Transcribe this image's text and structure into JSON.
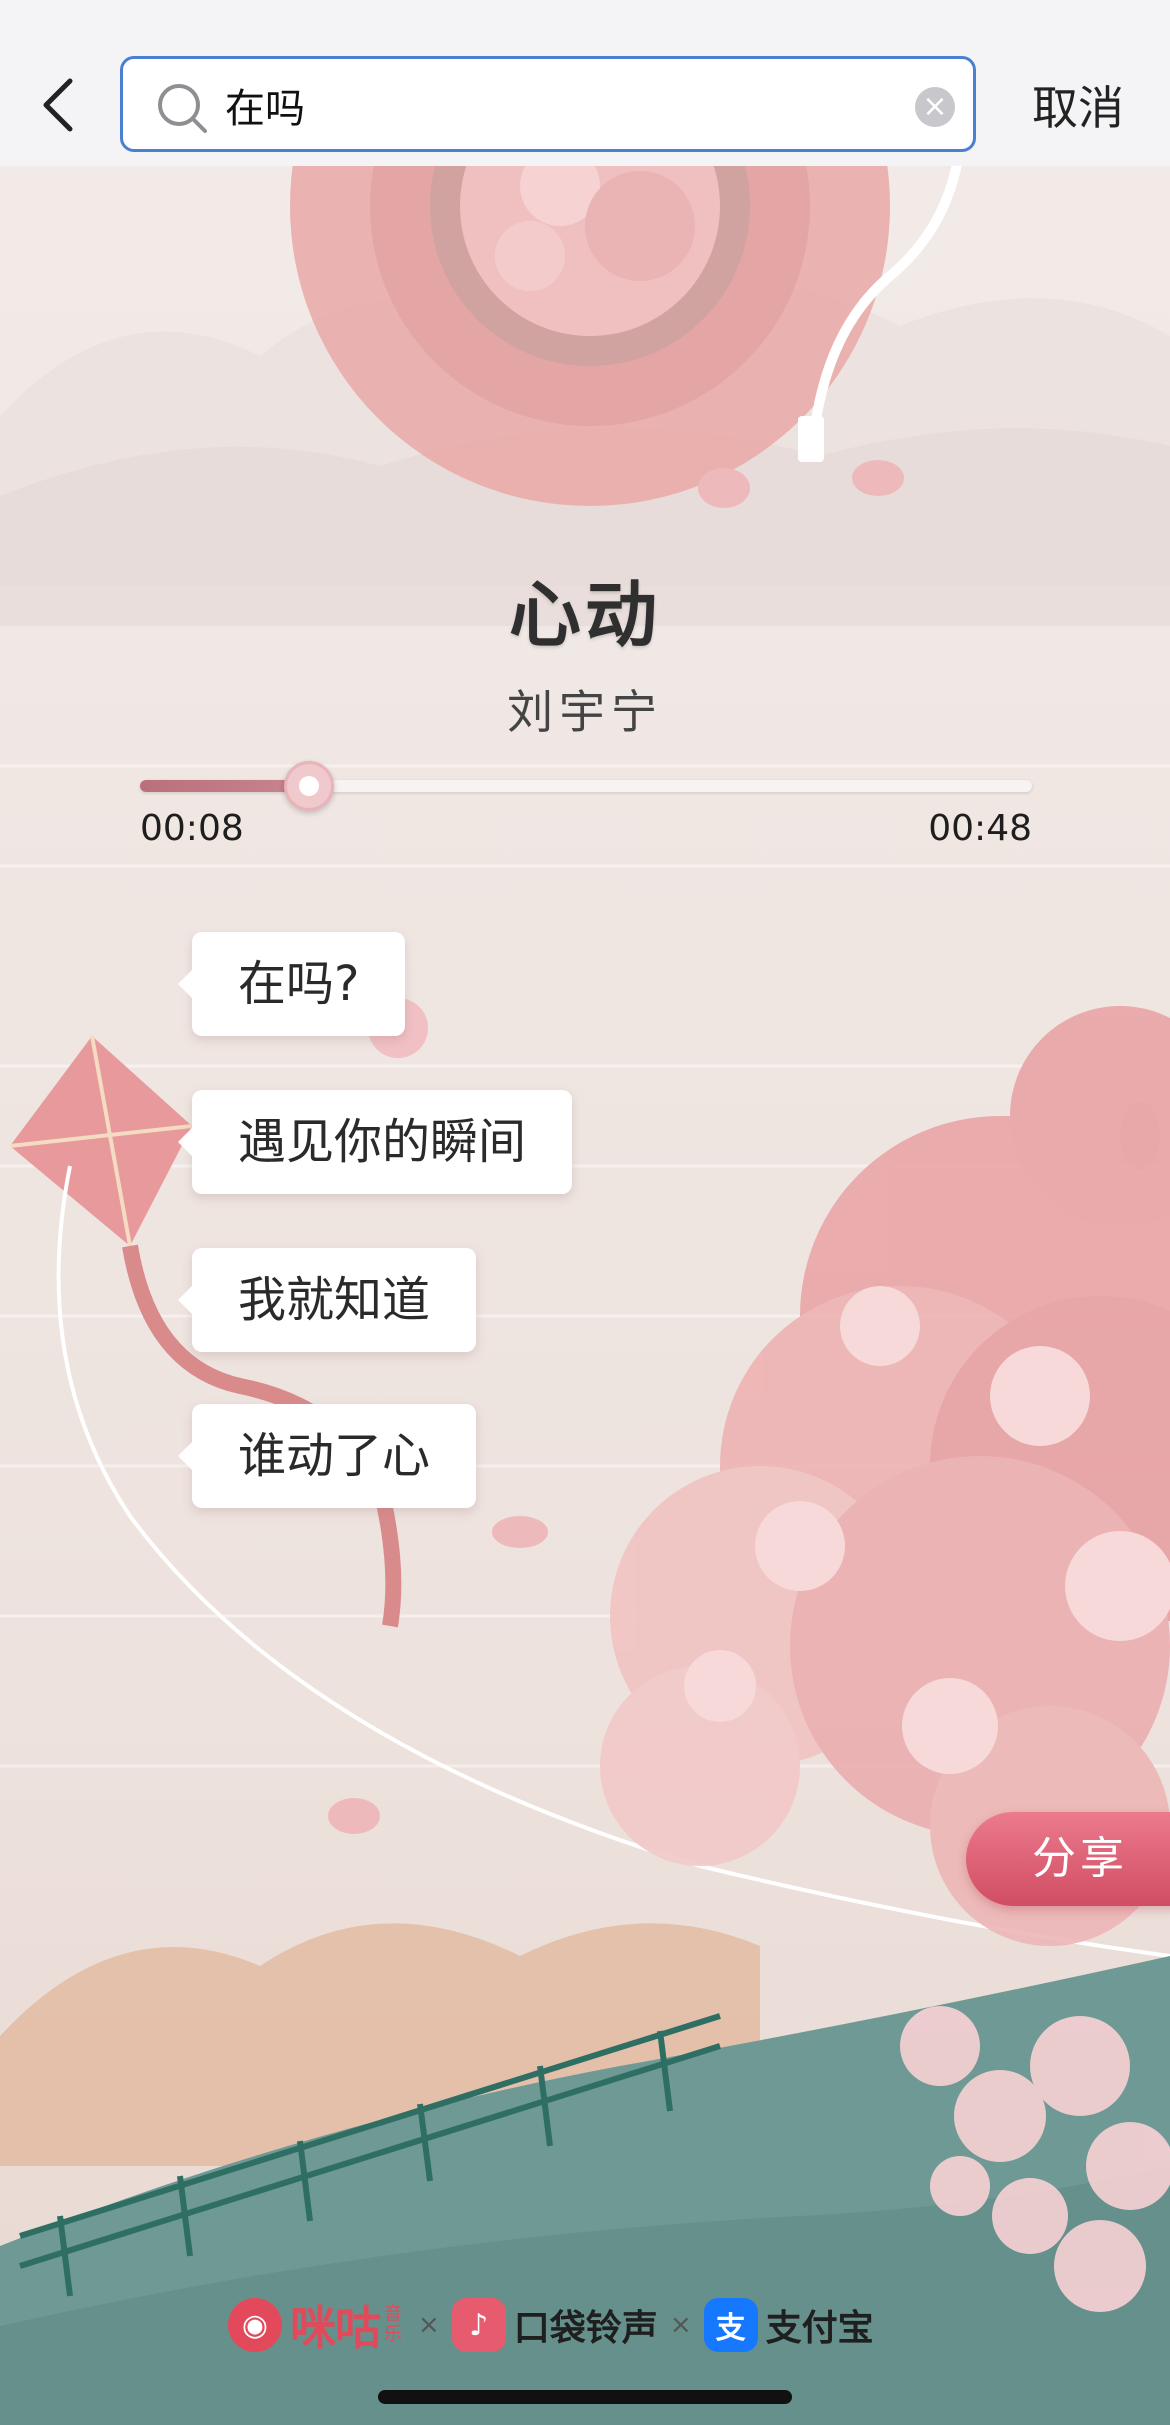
{
  "header": {
    "back_icon": "chevron-left-icon",
    "search": {
      "icon": "search-icon",
      "value": "在吗",
      "clear_icon": "clear-icon"
    },
    "cancel_label": "取消"
  },
  "player": {
    "title": "心动",
    "artist": "刘宇宁",
    "time_current": "00:08",
    "time_total": "00:48",
    "progress_fraction": 0.19
  },
  "lyrics": [
    {
      "text": "在吗?"
    },
    {
      "text": "遇见你的瞬间"
    },
    {
      "text": "我就知道"
    },
    {
      "text": "谁动了心"
    }
  ],
  "share_label": "分享",
  "footer": {
    "migu": {
      "name": "咪咕",
      "sub": "音乐"
    },
    "separator": "×",
    "pocket": {
      "name": "口袋铃声"
    },
    "alipay": {
      "badge": "支",
      "name": "支付宝"
    }
  },
  "colors": {
    "accent_search_border": "#4a7fd1",
    "share_button": "#d14d63",
    "progress_fill": "#b9707b",
    "migu_brand": "#e24a5b",
    "alipay_brand": "#1677ff"
  }
}
